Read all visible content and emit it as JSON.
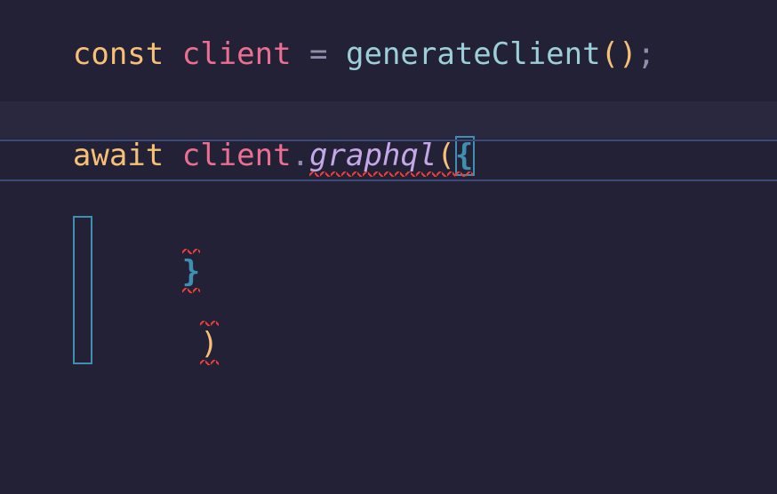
{
  "colors": {
    "background": "#232136",
    "highlight_bg": "#2a283e",
    "keyword": "#f6c177",
    "identifier": "#eb6f92",
    "operator": "#908caa",
    "function": "#9ccfd8",
    "method": "#c4a7e7",
    "paren": "#f6c177",
    "brace": "#3e8fb0",
    "error_squiggle": "#eb3d3d",
    "guide_line": "#3e4a78"
  },
  "code": {
    "line1": {
      "kw_const": "const",
      "sp1": " ",
      "ident_client": "client",
      "sp2": " ",
      "op_eq": "=",
      "sp3": " ",
      "fn_generateClient": "generateClient",
      "paren_open": "(",
      "paren_close": ")",
      "semi": ";"
    },
    "line3": {
      "kw_await": "await",
      "sp1": " ",
      "ident_client": "client",
      "op_dot": ".",
      "method_graphql": "graphql",
      "paren_open": "(",
      "brace_open": "{"
    },
    "line6": {
      "brace_close": "}",
      "paren_close": ")"
    }
  },
  "errors": {
    "graphql_call_underlined": true,
    "closing_tokens_underlined": true
  },
  "cursor": {
    "line": 3,
    "on_token": "brace_open"
  }
}
